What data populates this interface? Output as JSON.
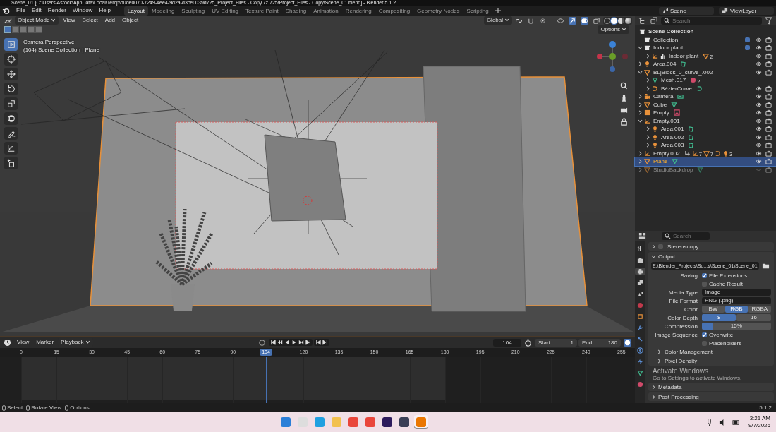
{
  "window": {
    "title": "Scene_01 [C:\\Users\\Asrock\\AppData\\Local\\Temp\\b0de0070-7249-4ee4-9d2a-d3ce0039d725_Project_Files - Copy.7z.725\\Project_Files - Copy\\Scene_01.blend] - Blender 5.1.2"
  },
  "menu": [
    "File",
    "Edit",
    "Render",
    "Window",
    "Help"
  ],
  "workspaces": [
    {
      "label": "Layout",
      "selected": true
    },
    {
      "label": "Modeling",
      "selected": false
    },
    {
      "label": "Sculpting",
      "selected": false
    },
    {
      "label": "UV Editing",
      "selected": false
    },
    {
      "label": "Texture Paint",
      "selected": false
    },
    {
      "label": "Shading",
      "selected": false
    },
    {
      "label": "Animation",
      "selected": false
    },
    {
      "label": "Rendering",
      "selected": false
    },
    {
      "label": "Compositing",
      "selected": false
    },
    {
      "label": "Geometry Nodes",
      "selected": false
    },
    {
      "label": "Scripting",
      "selected": false
    }
  ],
  "scene": "Scene",
  "view_layer": "ViewLayer",
  "viewport": {
    "mode": "Object Mode",
    "menus": [
      "View",
      "Select",
      "Add",
      "Object"
    ],
    "orientation": "Global",
    "options": "Options",
    "overlay_title": "Camera Perspective",
    "overlay_info": "(104) Scene Collection | Plane",
    "select_modes": [
      {
        "selected": true
      },
      {
        "selected": false
      },
      {
        "selected": false
      },
      {
        "selected": false
      },
      {
        "selected": false
      }
    ],
    "shading": [
      {
        "kind": "wireframe",
        "selected": false
      },
      {
        "kind": "solid",
        "selected": true
      },
      {
        "kind": "material",
        "selected": false
      },
      {
        "kind": "rendered",
        "selected": false
      }
    ],
    "tools": [
      {
        "kind": "select",
        "selected": true
      },
      {
        "kind": "cursor",
        "selected": false
      },
      {
        "kind": "move",
        "selected": false
      },
      {
        "kind": "rotate",
        "selected": false
      },
      {
        "kind": "scale",
        "selected": false
      },
      {
        "kind": "transform",
        "selected": false
      },
      {
        "kind": "annotate",
        "selected": false
      },
      {
        "kind": "measure",
        "selected": false
      },
      {
        "kind": "add-cube",
        "selected": false
      }
    ]
  },
  "outliner": {
    "search_placeholder": "Search",
    "root": "Scene Collection",
    "items": [
      {
        "name": "Collection",
        "kind": "collection",
        "selected": false,
        "checked": true,
        "visible": true
      },
      {
        "name": "Indoor plant",
        "kind": "collection",
        "selected": false,
        "expanded": true,
        "checked": true,
        "visible": true,
        "children": [
          {
            "name": "Indoor plant",
            "kind": "empty",
            "instance": true,
            "data": [
              {
                "kind": "mesh",
                "count": "2"
              }
            ],
            "selected": false,
            "expanded": false,
            "visible": true
          }
        ]
      },
      {
        "name": "Area.004",
        "kind": "light",
        "data": [
          {
            "kind": "light-data"
          }
        ],
        "selected": false,
        "expanded": false,
        "visible": true
      },
      {
        "name": "BL|Block_0_curve_.002",
        "kind": "mesh",
        "selected": false,
        "expanded": true,
        "visible": true,
        "children": [
          {
            "name": "Mesh.017",
            "kind": "mesh-data",
            "data": [
              {
                "kind": "material",
                "count": "2"
              }
            ],
            "selected": false,
            "expanded": false
          },
          {
            "name": "BézierCurve",
            "kind": "curve",
            "data": [
              {
                "kind": "curve-data"
              }
            ],
            "selected": false,
            "expanded": false,
            "visible": true
          }
        ]
      },
      {
        "name": "Camera",
        "kind": "camera",
        "data": [
          {
            "kind": "camera-data"
          }
        ],
        "selected": false,
        "expanded": false,
        "visible": true
      },
      {
        "name": "Cube",
        "kind": "mesh",
        "data": [
          {
            "kind": "mesh-data"
          }
        ],
        "selected": false,
        "expanded": false,
        "visible": true
      },
      {
        "name": "Empty",
        "kind": "image",
        "data": [
          {
            "kind": "image-data"
          }
        ],
        "selected": false,
        "expanded": false,
        "visible": true
      },
      {
        "name": "Empty.001",
        "kind": "empty",
        "selected": false,
        "expanded": true,
        "visible": true,
        "children": [
          {
            "name": "Area.001",
            "kind": "light",
            "data": [
              {
                "kind": "light-data"
              }
            ],
            "selected": false,
            "expanded": false,
            "visible": true
          },
          {
            "name": "Area.002",
            "kind": "light",
            "data": [
              {
                "kind": "light-data"
              }
            ],
            "selected": false,
            "expanded": false,
            "visible": true
          },
          {
            "name": "Area.003",
            "kind": "light",
            "data": [
              {
                "kind": "light-data"
              }
            ],
            "selected": false,
            "expanded": false,
            "visible": true
          }
        ]
      },
      {
        "name": "Empty.002",
        "kind": "empty",
        "data": [
          {
            "kind": "link"
          },
          {
            "kind": "empty",
            "count": "7"
          },
          {
            "kind": "mesh",
            "count": "7"
          },
          {
            "kind": "curve"
          },
          {
            "kind": "light",
            "count": "3"
          }
        ],
        "selected": false,
        "expanded": false,
        "visible": true
      },
      {
        "name": "Plane",
        "kind": "mesh",
        "data": [
          {
            "kind": "mesh-data"
          }
        ],
        "selected": true,
        "expanded": false,
        "visible": true
      },
      {
        "name": "StudioBackdrop",
        "kind": "mesh",
        "data": [
          {
            "kind": "mesh-data"
          }
        ],
        "selected": false,
        "expanded": false,
        "visible": false
      }
    ]
  },
  "properties": {
    "search_placeholder": "Search",
    "tabs": [
      {
        "kind": "tool",
        "selected": false
      },
      {
        "kind": "render",
        "selected": false
      },
      {
        "kind": "output",
        "selected": true
      },
      {
        "kind": "view-layer",
        "selected": false
      },
      {
        "kind": "scene",
        "selected": false
      },
      {
        "kind": "world",
        "selected": false
      },
      {
        "kind": "object",
        "selected": false
      },
      {
        "kind": "modifier",
        "selected": false
      },
      {
        "kind": "particles",
        "selected": false
      },
      {
        "kind": "physics",
        "selected": false
      },
      {
        "kind": "constraint",
        "selected": false
      },
      {
        "kind": "data",
        "selected": false
      },
      {
        "kind": "material",
        "selected": false
      }
    ],
    "stereoscopy": {
      "title": "Stereoscopy",
      "expanded": false,
      "checked": false
    },
    "output": {
      "title": "Output",
      "expanded": true,
      "path": "E:\\Blender_Projects\\So...s\\Scene_01\\Scene_01",
      "rows": [
        {
          "kind": "checkbox",
          "label": "Saving",
          "text": "File Extensions",
          "checked": true
        },
        {
          "kind": "checkbox",
          "text": "Cache Result",
          "checked": false
        },
        {
          "kind": "dropdown",
          "label": "Media Type",
          "value": "Image"
        },
        {
          "kind": "dropdown",
          "label": "File Format",
          "value": "PNG (.png)"
        },
        {
          "kind": "segmented",
          "label": "Color",
          "options": [
            {
              "label": "BW",
              "selected": false
            },
            {
              "label": "RGB",
              "selected": true
            },
            {
              "label": "RGBA",
              "selected": false
            }
          ]
        },
        {
          "kind": "segmented",
          "label": "Color Depth",
          "options": [
            {
              "label": "8",
              "selected": true
            },
            {
              "label": "16",
              "selected": false
            }
          ]
        },
        {
          "kind": "slider",
          "label": "Compression",
          "level": 0.15,
          "reading": "15%"
        },
        {
          "kind": "checkbox",
          "label": "Image Sequence",
          "text": "Overwrite",
          "checked": true
        },
        {
          "kind": "checkbox",
          "text": "Placeholders",
          "checked": false
        }
      ],
      "subpanels": [
        {
          "title": "Color Management",
          "expanded": false
        },
        {
          "title": "Pixel Density",
          "expanded": false
        }
      ]
    },
    "panels": [
      {
        "title": "Metadata",
        "expanded": false
      },
      {
        "title": "Post Processing",
        "expanded": false
      }
    ]
  },
  "os_notice": {
    "title": "Activate Windows",
    "text": "Go to Settings to activate Windows."
  },
  "timeline": {
    "menus": [
      "View",
      "Marker"
    ],
    "playback": "Playback",
    "current_frame": "104",
    "playhead_label": "104",
    "start_label": "Start",
    "start": "1",
    "end_label": "End",
    "end": "180",
    "ticks": [
      "0",
      "15",
      "30",
      "45",
      "60",
      "75",
      "90",
      "120",
      "135",
      "150",
      "165",
      "180",
      "195",
      "210",
      "225",
      "240",
      "255"
    ]
  },
  "status_bar": {
    "items": [
      "Select",
      "Rotate View",
      "Options"
    ],
    "version": "5.1.2"
  },
  "taskbar": {
    "apps": [
      {
        "kind": "start",
        "selected": false
      },
      {
        "kind": "search",
        "selected": false
      },
      {
        "kind": "browser",
        "selected": false
      },
      {
        "kind": "folder",
        "selected": false
      },
      {
        "kind": "chrome",
        "selected": false
      },
      {
        "kind": "chrome",
        "selected": false
      },
      {
        "kind": "after-effects",
        "selected": false
      },
      {
        "kind": "resolve",
        "selected": false
      },
      {
        "kind": "blender",
        "selected": true
      }
    ],
    "time": "3:21 AM",
    "date": "9/7/2026"
  }
}
